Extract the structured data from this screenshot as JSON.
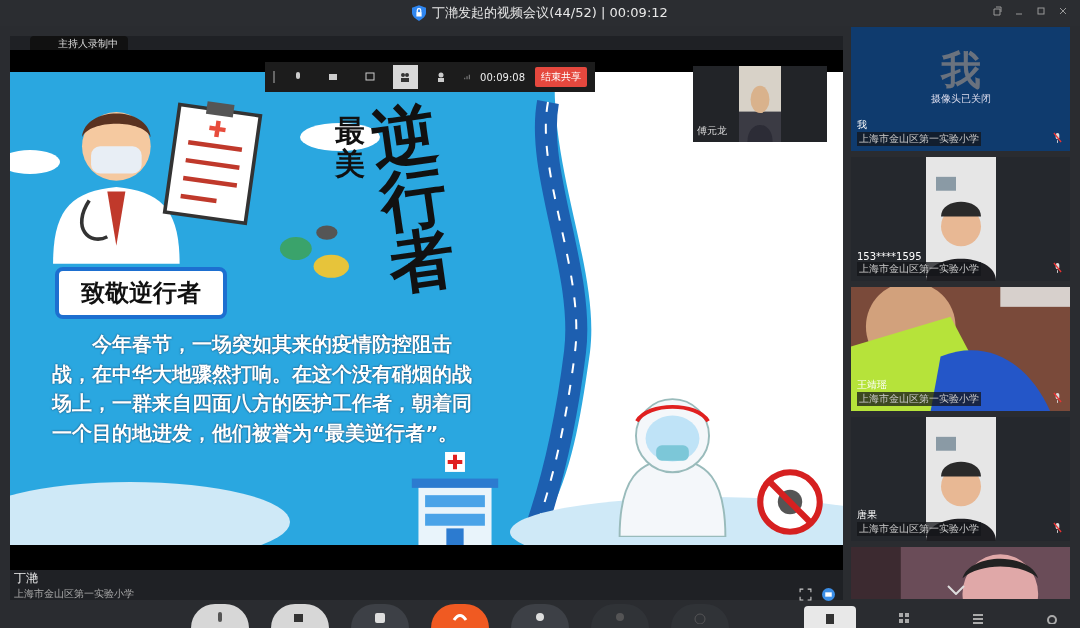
{
  "window": {
    "title": "丁滟发起的视频会议(44/52) | 00:09:12"
  },
  "main_view": {
    "recording_label": "主持人录制中",
    "share_toolbar": {
      "timer": "00:09:08",
      "stop_button": "结束共享",
      "tools": [
        {
          "kind": "mic"
        },
        {
          "kind": "camera"
        },
        {
          "kind": "share"
        },
        {
          "kind": "mute_all",
          "selected": true
        },
        {
          "kind": "invite",
          "selected": false
        }
      ]
    },
    "floating_video": {
      "name": "傅元龙"
    },
    "slide": {
      "banner": "致敬逆行者",
      "title_small": "最美",
      "title_big": "逆行者",
      "paragraph": "今年春节，一场突如其来的疫情防控阻击战，在中华大地骤然打响。在这个没有硝烟的战场上，一群来自四面八方的医护工作者，朝着同一个目的地进发，他们被誉为“最美逆行者”。"
    },
    "presenter": {
      "name": "丁滟",
      "school": "上海市金山区第一实验小学"
    }
  },
  "participants": [
    {
      "kind": "camera_off",
      "avatar": "我",
      "status": "摄像头已关闭",
      "name": "我",
      "school": "上海市金山区第一实验小学",
      "muted": true
    },
    {
      "kind": "portrait",
      "name": "153****1595",
      "school": "上海市金山区第一实验小学",
      "muted": true
    },
    {
      "kind": "wide",
      "name": "王靖瑶",
      "school": "上海市金山区第一实验小学",
      "muted": true
    },
    {
      "kind": "portrait",
      "name": "唐果",
      "school": "上海市金山区第一实验小学",
      "muted": true
    },
    {
      "kind": "partial"
    }
  ],
  "sidebar_tabs": [
    {
      "kind": "speaker",
      "selected": true
    },
    {
      "kind": "grid",
      "selected": false
    },
    {
      "kind": "list",
      "selected": false
    },
    {
      "kind": "settings",
      "selected": false
    }
  ],
  "controls": [
    {
      "kind": "mic",
      "disabled": false
    },
    {
      "kind": "camera",
      "disabled": false
    },
    {
      "kind": "share",
      "disabled": false
    },
    {
      "kind": "hangup",
      "disabled": false
    },
    {
      "kind": "members",
      "disabled": false
    },
    {
      "kind": "mute_all",
      "disabled": true
    },
    {
      "kind": "record",
      "disabled": true
    }
  ]
}
